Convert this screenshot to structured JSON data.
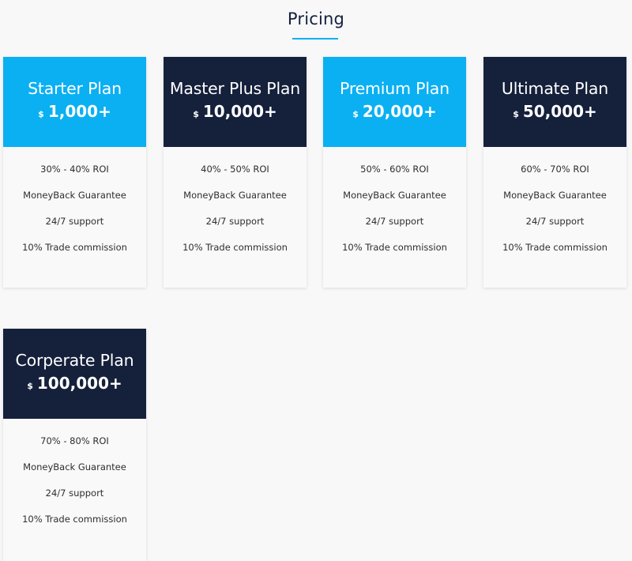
{
  "section": {
    "title": "Pricing",
    "accent_color": "#0ab0f2",
    "title_color": "#14213d"
  },
  "plans": [
    {
      "name": "Starter Plan",
      "currency": "$",
      "price": "1,000+",
      "header_color": "#0ab0f2",
      "features": [
        "30% - 40% ROI",
        "MoneyBack Guarantee",
        "24/7 support",
        "10% Trade commission"
      ]
    },
    {
      "name": "Master Plus Plan",
      "currency": "$",
      "price": "10,000+",
      "header_color": "#15203b",
      "features": [
        "40% - 50% ROI",
        "MoneyBack Guarantee",
        "24/7 support",
        "10% Trade commission"
      ]
    },
    {
      "name": "Premium Plan",
      "currency": "$",
      "price": "20,000+",
      "header_color": "#0ab0f2",
      "features": [
        "50% - 60% ROI",
        "MoneyBack Guarantee",
        "24/7 support",
        "10% Trade commission"
      ]
    },
    {
      "name": "Ultimate Plan",
      "currency": "$",
      "price": "50,000+",
      "header_color": "#15203b",
      "features": [
        "60% - 70% ROI",
        "MoneyBack Guarantee",
        "24/7 support",
        "10% Trade commission"
      ]
    },
    {
      "name": "Corperate Plan",
      "currency": "$",
      "price": "100,000+",
      "header_color": "#15203b",
      "features": [
        "70% - 80% ROI",
        "MoneyBack Guarantee",
        "24/7 support",
        "10% Trade commission"
      ]
    }
  ]
}
